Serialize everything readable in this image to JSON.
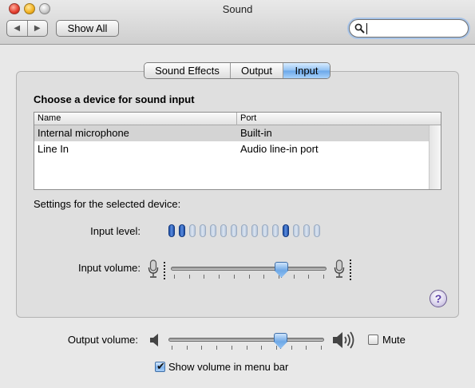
{
  "window": {
    "title": "Sound"
  },
  "toolbar": {
    "back_glyph": "◀",
    "forward_glyph": "▶",
    "show_all_label": "Show All",
    "search_placeholder": "",
    "search_value": ""
  },
  "tabs": [
    {
      "label": "Sound Effects",
      "selected": false
    },
    {
      "label": "Output",
      "selected": false
    },
    {
      "label": "Input",
      "selected": true
    }
  ],
  "input": {
    "heading": "Choose a device for sound input",
    "table": {
      "columns": [
        "Name",
        "Port"
      ],
      "rows": [
        {
          "name": "Internal microphone",
          "port": "Built-in",
          "selected": true
        },
        {
          "name": "Line In",
          "port": "Audio line-in port",
          "selected": false
        }
      ]
    },
    "settings_label": "Settings for the selected device:",
    "input_level_label": "Input level:",
    "input_level": {
      "segments_total": 15,
      "lit_segments": [
        1,
        2,
        12
      ]
    },
    "input_volume_label": "Input volume:",
    "input_volume_fraction": 0.73,
    "help_glyph": "?"
  },
  "output": {
    "output_volume_label": "Output volume:",
    "output_volume_fraction": 0.74,
    "mute_label": "Mute",
    "mute_checked": false,
    "show_volume_label": "Show volume in menu bar",
    "show_volume_checked": true,
    "check_glyph": "✔"
  },
  "colors": {
    "selected_tab": "#8fc0f2",
    "level_on": "#1d4fa8",
    "level_off": "#c6d3e6",
    "window_bg": "#e8e8e8"
  },
  "icons": {
    "mic_low": "microphone-icon",
    "mic_high": "microphone-icon",
    "speaker_low": "speaker-low-icon",
    "speaker_high": "speaker-high-icon",
    "search": "search-icon"
  }
}
